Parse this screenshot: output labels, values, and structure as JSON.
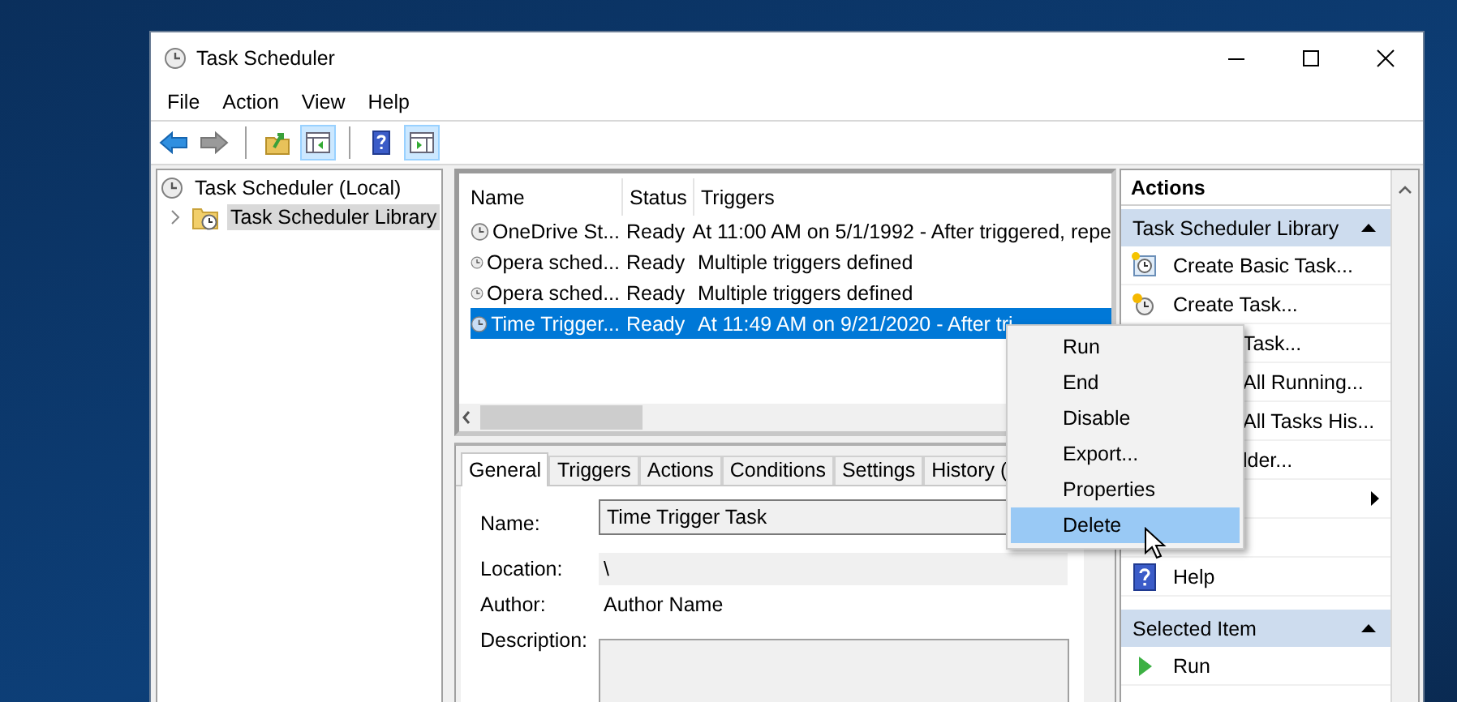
{
  "window": {
    "title": "Task Scheduler"
  },
  "menu": [
    "File",
    "Action",
    "View",
    "Help"
  ],
  "toolbar": [
    {
      "kind": "back",
      "pressed": false
    },
    {
      "kind": "forward",
      "pressed": false
    },
    {
      "kind": "separator"
    },
    {
      "kind": "up-folder",
      "pressed": false
    },
    {
      "kind": "tree-toggle",
      "pressed": true
    },
    {
      "kind": "separator"
    },
    {
      "kind": "help",
      "pressed": false
    },
    {
      "kind": "pane-toggle",
      "pressed": true
    }
  ],
  "tree": [
    {
      "label": "Task Scheduler (Local)",
      "selected": false,
      "children": [
        {
          "label": "Task Scheduler Library",
          "selected": true,
          "expanded": false
        }
      ]
    }
  ],
  "task_list": {
    "columns": [
      "Name",
      "Status",
      "Triggers"
    ],
    "rows": [
      {
        "name": "OneDrive St...",
        "status": "Ready",
        "triggers": "At 11:00 AM on 5/1/1992 - After triggered, repe",
        "selected": false
      },
      {
        "name": "Opera sched...",
        "status": "Ready",
        "triggers": "Multiple triggers defined",
        "selected": false
      },
      {
        "name": "Opera sched...",
        "status": "Ready",
        "triggers": "Multiple triggers defined",
        "selected": false
      },
      {
        "name": "Time Trigger...",
        "status": "Ready",
        "triggers": "At 11:49 AM on 9/21/2020 - After tri",
        "selected": true
      }
    ]
  },
  "details": {
    "tabs": [
      {
        "label": "General",
        "selected": true
      },
      {
        "label": "Triggers",
        "selected": false
      },
      {
        "label": "Actions",
        "selected": false
      },
      {
        "label": "Conditions",
        "selected": false
      },
      {
        "label": "Settings",
        "selected": false
      },
      {
        "label": "History (",
        "selected": false
      }
    ],
    "fields": [
      {
        "label": "Name:",
        "kind": "input",
        "value": "Time Trigger Task"
      },
      {
        "label": "Location:",
        "kind": "readonly",
        "value": "\\"
      },
      {
        "label": "Author:",
        "kind": "text",
        "value": "Author Name"
      },
      {
        "label": "Description:",
        "kind": "textarea"
      }
    ]
  },
  "actions": {
    "title": "Actions",
    "sections": [
      {
        "title": "Task Scheduler Library",
        "expanded": true,
        "items": [
          {
            "kind": "basic-task",
            "label": "Create Basic Task..."
          },
          {
            "kind": "task",
            "label": "Create Task..."
          },
          {
            "kind": "covered",
            "label": "Task..."
          },
          {
            "kind": "covered",
            "label": "All Running..."
          },
          {
            "kind": "covered",
            "label": "All Tasks His..."
          },
          {
            "kind": "covered",
            "label": "lder..."
          },
          {
            "kind": "covered-submenu"
          },
          {
            "kind": "blank"
          },
          {
            "kind": "help",
            "label": "Help"
          }
        ]
      },
      {
        "title": "Selected Item",
        "expanded": true,
        "items": [
          {
            "kind": "run",
            "label": "Run"
          }
        ]
      }
    ]
  },
  "context_menu": [
    {
      "label": "Run",
      "selected": false
    },
    {
      "label": "End",
      "selected": false
    },
    {
      "label": "Disable",
      "selected": false
    },
    {
      "label": "Export...",
      "selected": false
    },
    {
      "label": "Properties",
      "selected": false
    },
    {
      "label": "Delete",
      "selected": true
    }
  ]
}
